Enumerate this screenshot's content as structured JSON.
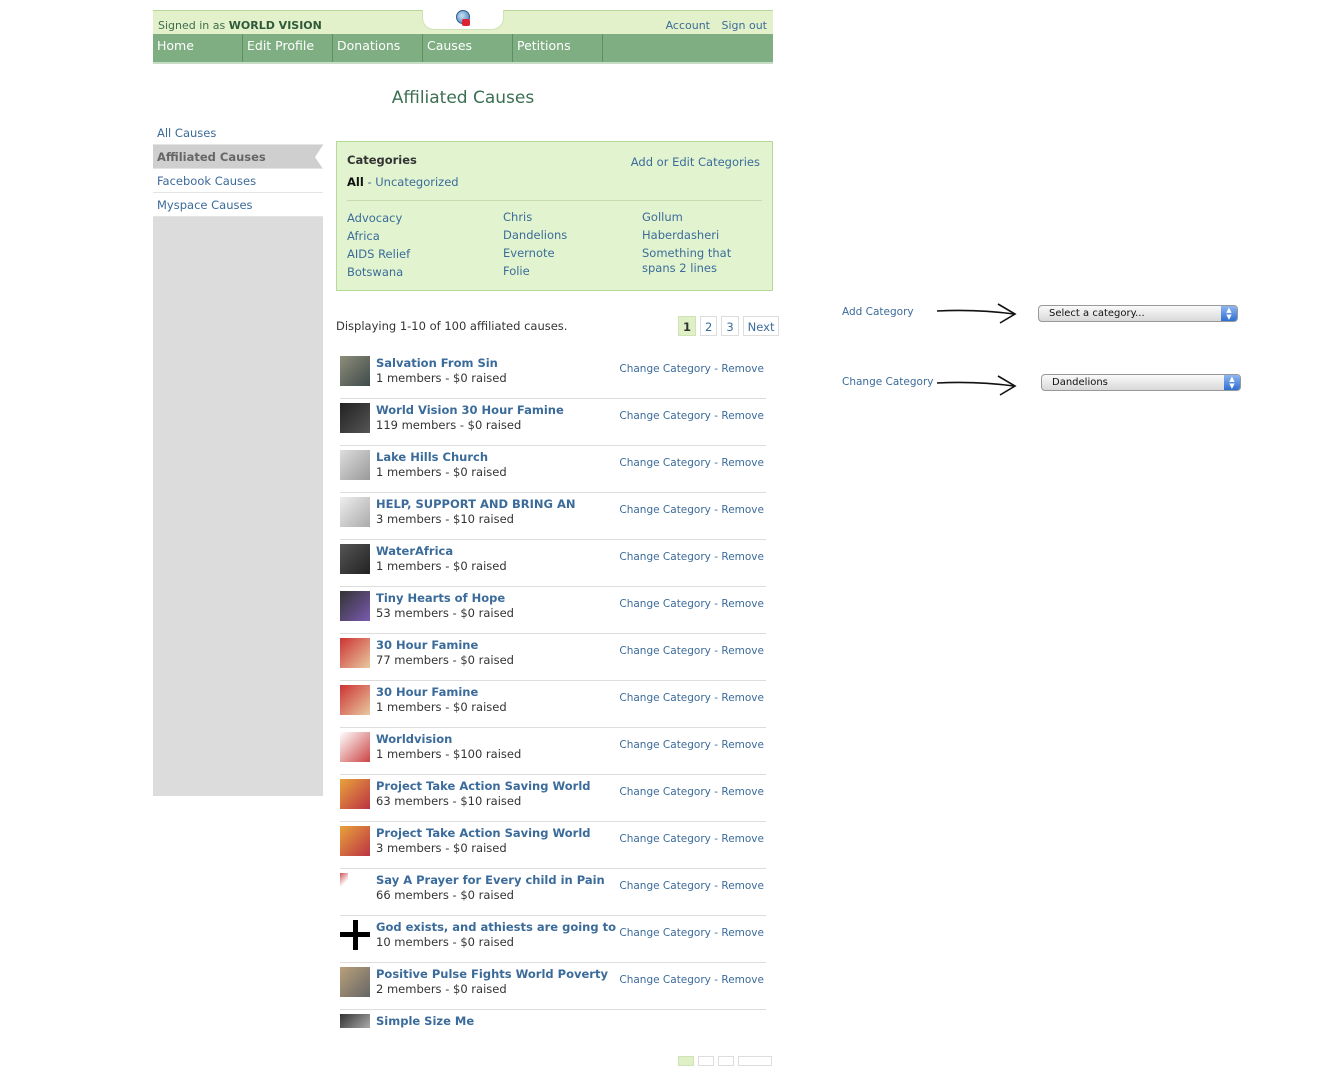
{
  "header": {
    "signed_prefix": "Signed in as",
    "user_name": "WORLD VISION",
    "account": "Account",
    "sign_out": "Sign out",
    "nav": [
      "Home",
      "Edit Profile",
      "Donations",
      "Causes",
      "Petitions"
    ]
  },
  "page_title": "Affiliated Causes",
  "sidebar": {
    "items": [
      {
        "label": "All Causes"
      },
      {
        "label": "Affiliated Causes"
      },
      {
        "label": "Facebook Causes"
      },
      {
        "label": "Myspace Causes"
      }
    ],
    "active": "Affiliated Causes"
  },
  "categories": {
    "title": "Categories",
    "edit_link": "Add or Edit Categories",
    "all": "All",
    "uncategorized": "- Uncategorized",
    "col1": [
      "Advocacy",
      "Africa",
      "AIDS Relief",
      "Botswana"
    ],
    "col2": [
      "Chris",
      "Dandelions",
      "Evernote",
      "Folie"
    ],
    "col3": [
      "Gollum",
      "Haberdasheri",
      "Something that spans 2 lines"
    ]
  },
  "listing": {
    "count_text": "Displaying 1-10 of 100 affiliated causes.",
    "pages": [
      "1",
      "2",
      "3",
      "Next"
    ],
    "change_category": "Change Category",
    "remove": "Remove",
    "rows": [
      {
        "title": "Salvation From Sin",
        "meta": "1 members - $0 raised"
      },
      {
        "title": "World Vision 30 Hour Famine",
        "meta": "119 members - $0 raised"
      },
      {
        "title": "Lake Hills Church",
        "meta": "1 members - $0 raised"
      },
      {
        "title": "HELP, SUPPORT AND BRING AN",
        "meta": "3 members - $10 raised"
      },
      {
        "title": "WaterAfrica",
        "meta": "1 members - $0 raised"
      },
      {
        "title": "Tiny Hearts of Hope",
        "meta": "53 members - $0 raised"
      },
      {
        "title": "30 Hour Famine",
        "meta": "77 members - $0 raised"
      },
      {
        "title": "30 Hour Famine",
        "meta": "1 members - $0 raised"
      },
      {
        "title": "Worldvision",
        "meta": "1 members - $100 raised"
      },
      {
        "title": "Project Take Action Saving World",
        "meta": "63 members - $10 raised"
      },
      {
        "title": "Project Take Action Saving World",
        "meta": "3 members - $0 raised"
      },
      {
        "title": "Say A Prayer for Every child in Pain",
        "meta": "66 members - $0 raised"
      },
      {
        "title": "God exists, and athiests are going to",
        "meta": "10 members - $0 raised"
      },
      {
        "title": "Positive Pulse Fights World Poverty",
        "meta": "2 members - $0 raised"
      },
      {
        "title": "Simple Size Me",
        "meta": ""
      }
    ]
  },
  "annotations": {
    "add_label": "Add Category",
    "add_select": "Select a category...",
    "change_label": "Change Category",
    "change_select": "Dandelions"
  }
}
